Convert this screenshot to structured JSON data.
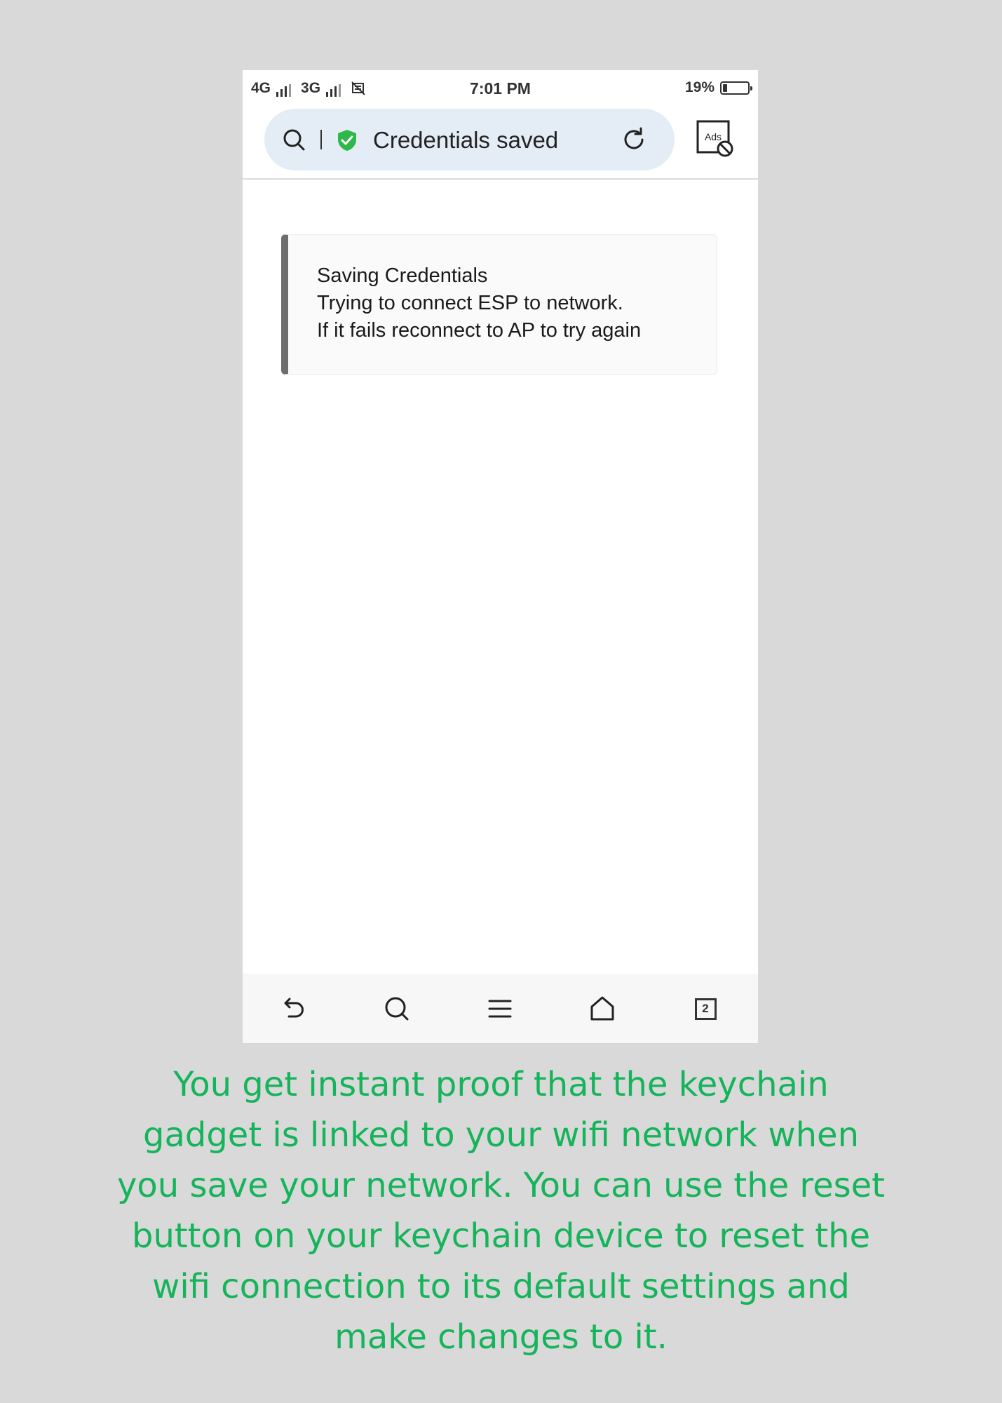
{
  "status_bar": {
    "network_1": "4G",
    "network_2": "3G",
    "time": "7:01 PM",
    "battery": "19%",
    "battery_level": 0.19
  },
  "address_bar": {
    "title": "Credentials saved",
    "secure_color": "#2fb84a"
  },
  "ads_button": {
    "label": "Ads"
  },
  "message": {
    "lines": [
      "Saving Credentials",
      "Trying to connect ESP to network.",
      "If it fails reconnect to AP to try again"
    ]
  },
  "bottom_nav": {
    "items": [
      "back-icon",
      "search-icon",
      "menu-icon",
      "home-icon",
      "tabs-icon"
    ],
    "tab_count": "2"
  },
  "caption": {
    "color": "#16b45a",
    "lines": [
      "You get instant proof that the keychain",
      "gadget is linked to your wifi network when",
      "you save your network. You can use the reset",
      "button on your keychain device to reset the",
      "wifi connection to its default settings and",
      "make changes to it."
    ]
  }
}
